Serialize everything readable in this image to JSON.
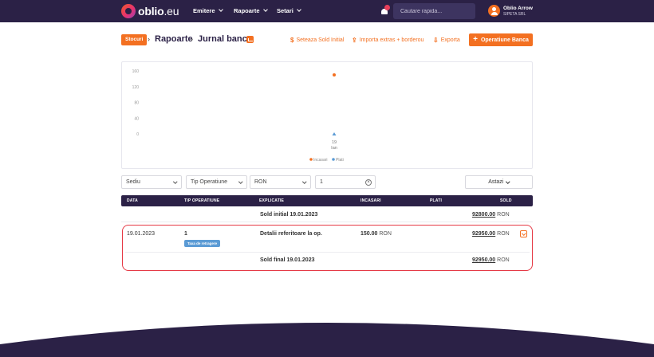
{
  "nav": {
    "logo_main": "oblio",
    "logo_suffix": ".eu",
    "items": [
      {
        "label": "Emitere"
      },
      {
        "label": "Rapoarte"
      },
      {
        "label": "Setari"
      }
    ],
    "search_placeholder": "Cautare rapida...",
    "user": {
      "name": "Oblio Arrow",
      "company": "SIPETA SRL"
    },
    "icons": {
      "notification": "bell-icon",
      "avatar": "user-icon"
    }
  },
  "header": {
    "chip": "Stocuri",
    "breadcrumb": [
      "Rapoarte",
      "Jurnal banca"
    ],
    "links": [
      {
        "icon": "$",
        "label": "Seteaza Sold Initial"
      },
      {
        "icon": "⇪",
        "label": "Importa extras + borderou"
      },
      {
        "icon": "⇩",
        "label": "Exporta"
      }
    ],
    "add_button": "Operatiune Banca"
  },
  "chart_data": {
    "type": "scatter",
    "y_ticks": [
      "160",
      "120",
      "80",
      "40",
      "0"
    ],
    "ylim": [
      0,
      160
    ],
    "categories": [
      "19",
      "Ian"
    ],
    "x_label_day": "19",
    "x_label_month": "Ian",
    "series": [
      {
        "name": "Incasari",
        "color": "#f37021",
        "values": [
          150
        ]
      },
      {
        "name": "Plati",
        "color": "#5b9bd5",
        "values": [
          0
        ]
      }
    ],
    "legend_position": "bottom",
    "grid": false
  },
  "filters": {
    "sediu": "Sediu",
    "tip": "Tip Operatiune",
    "currency": "RON",
    "number": "1",
    "period": "Astazi"
  },
  "table": {
    "columns": [
      "DATA",
      "TIP OPERATIUNE",
      "EXPLICATIE",
      "INCASARI",
      "PLATI",
      "SOLD"
    ],
    "initial": {
      "label": "Sold initial 19.01.2023",
      "sold": "92800.00",
      "currency": "RON"
    },
    "rows": [
      {
        "date": "19.01.2023",
        "tip": "1",
        "tag": "Taxa de retragere",
        "explicatie": "Detalii referitoare la op.",
        "incasari": "150.00",
        "currency": "RON",
        "sold": "92950.00"
      }
    ],
    "final": {
      "label": "Sold final 19.01.2023",
      "sold": "92950.00",
      "currency": "RON"
    }
  },
  "colors": {
    "brand": "#2b2146",
    "accent": "#f37021",
    "highlight": "#e53945"
  }
}
